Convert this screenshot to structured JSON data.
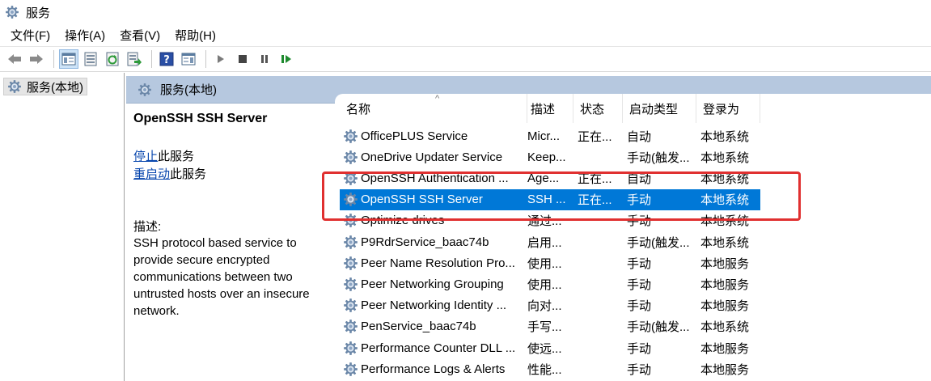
{
  "window": {
    "title": "服务",
    "icon": "services-gear-icon"
  },
  "menu": [
    {
      "label": "文件(F)"
    },
    {
      "label": "操作(A)"
    },
    {
      "label": "查看(V)"
    },
    {
      "label": "帮助(H)"
    }
  ],
  "toolbar": {
    "buttons": [
      "back-arrow-icon",
      "forward-arrow-icon",
      "show-hide-console-tree-icon",
      "properties-icon",
      "refresh-icon",
      "export-list-icon",
      "help-icon",
      "show-hide-action-pane-icon",
      "start-service-icon",
      "stop-service-icon",
      "pause-service-icon",
      "restart-service-icon"
    ]
  },
  "tree": {
    "root_label": "服务(本地)"
  },
  "pane_header": {
    "title": "服务(本地)"
  },
  "details": {
    "service_name": "OpenSSH SSH Server",
    "stop_link": "停止",
    "stop_suffix": "此服务",
    "restart_link": "重启动",
    "restart_suffix": "此服务",
    "description_label": "描述:",
    "description_lines": [
      "SSH protocol based service to",
      "provide secure encrypted",
      "communications between two",
      "untrusted hosts over an insecure",
      "network."
    ]
  },
  "columns": {
    "name": "名称",
    "description": "描述",
    "status": "状态",
    "startup_type": "启动类型",
    "logon_as": "登录为",
    "sort_indicator": "^"
  },
  "services": [
    {
      "name": "OfficePLUS Service",
      "description": "Micr...",
      "status": "正在...",
      "startup": "自动",
      "logon": "本地系统"
    },
    {
      "name": "OneDrive Updater Service",
      "description": "Keep...",
      "status": "",
      "startup": "手动(触发...",
      "logon": "本地系统"
    },
    {
      "name": "OpenSSH Authentication ...",
      "description": "Age...",
      "status": "正在...",
      "startup": "自动",
      "logon": "本地系统"
    },
    {
      "name": "OpenSSH SSH Server",
      "description": "SSH ...",
      "status": "正在...",
      "startup": "手动",
      "logon": "本地系统",
      "selected": true
    },
    {
      "name": "Optimize drives",
      "description": "通过...",
      "status": "",
      "startup": "手动",
      "logon": "本地系统"
    },
    {
      "name": "P9RdrService_baac74b",
      "description": "启用...",
      "status": "",
      "startup": "手动(触发...",
      "logon": "本地系统"
    },
    {
      "name": "Peer Name Resolution Pro...",
      "description": "使用...",
      "status": "",
      "startup": "手动",
      "logon": "本地服务"
    },
    {
      "name": "Peer Networking Grouping",
      "description": "使用...",
      "status": "",
      "startup": "手动",
      "logon": "本地服务"
    },
    {
      "name": "Peer Networking Identity ...",
      "description": "向对...",
      "status": "",
      "startup": "手动",
      "logon": "本地服务"
    },
    {
      "name": "PenService_baac74b",
      "description": "手写...",
      "status": "",
      "startup": "手动(触发...",
      "logon": "本地系统"
    },
    {
      "name": "Performance Counter DLL ...",
      "description": "使远...",
      "status": "",
      "startup": "手动",
      "logon": "本地服务"
    },
    {
      "name": "Performance Logs & Alerts",
      "description": "性能...",
      "status": "",
      "startup": "手动",
      "logon": "本地服务"
    }
  ],
  "colors": {
    "selection": "#0078d7",
    "highlight_box": "#e03030",
    "header_band": "#b6c8df",
    "link": "#0645ad"
  }
}
